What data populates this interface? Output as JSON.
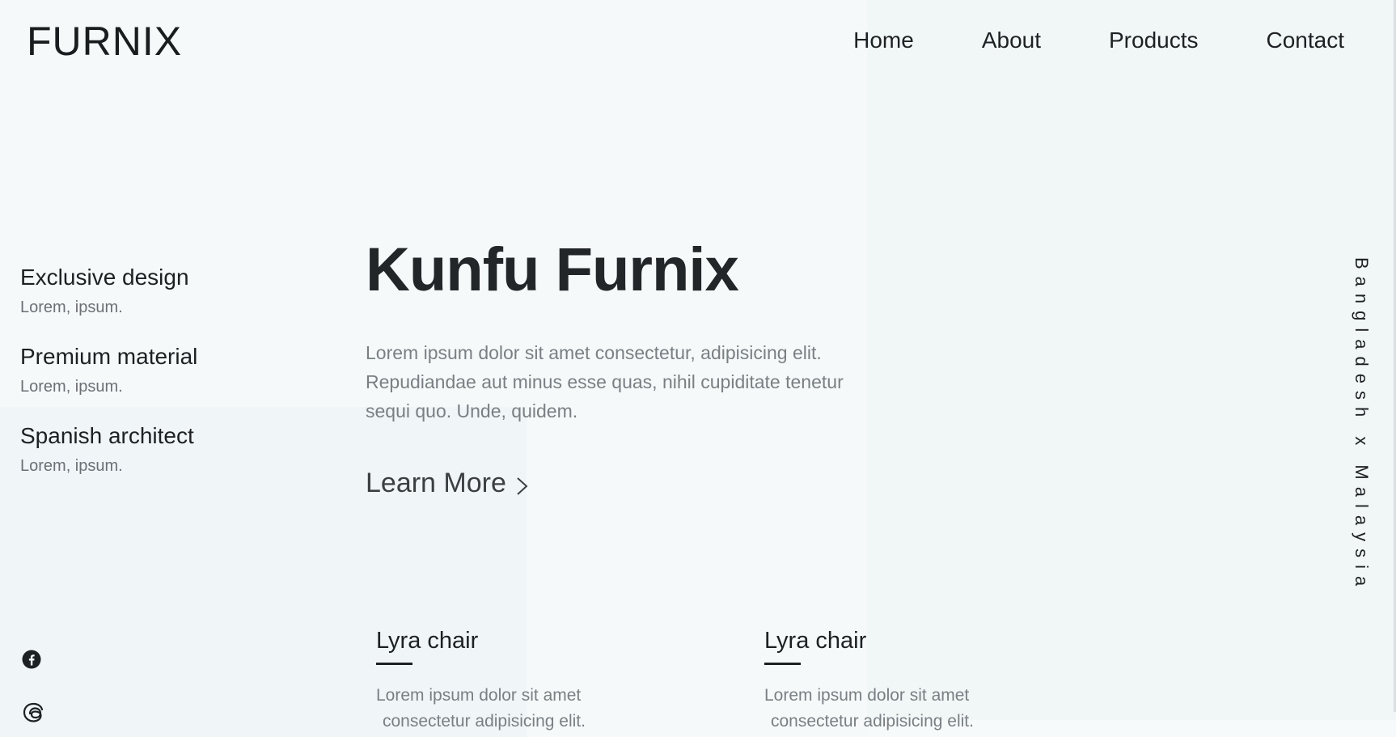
{
  "brand": {
    "logo": "FURNIX"
  },
  "nav": {
    "items": [
      "Home",
      "About",
      "Products",
      "Contact"
    ]
  },
  "features": [
    {
      "title": "Exclusive design",
      "subtitle": "Lorem, ipsum."
    },
    {
      "title": "Premium material",
      "subtitle": "Lorem, ipsum."
    },
    {
      "title": "Spanish architect",
      "subtitle": "Lorem, ipsum."
    }
  ],
  "hero": {
    "title": "Kunfu Furnix",
    "text": "Lorem ipsum dolor sit amet consectetur, adipisicing elit. Repudiandae aut minus esse quas, nihil cupiditate tenetur sequi quo. Unde, quidem.",
    "cta": "Learn More"
  },
  "side_caption": "Bangladesh x Malaysia",
  "social": {
    "icons": [
      "facebook-icon",
      "threads-icon"
    ]
  },
  "cards": [
    {
      "name": "Lyra chair",
      "desc_line1": "Lorem ipsum dolor sit amet",
      "desc_line2": "consectetur adipisicing elit."
    },
    {
      "name": "Lyra chair",
      "desc_line1": "Lorem ipsum dolor sit amet",
      "desc_line2": "consectetur adipisicing elit."
    }
  ],
  "colors": {
    "background": "#f5f9fa",
    "text": "#1d2124",
    "muted": "#7a7f83"
  }
}
